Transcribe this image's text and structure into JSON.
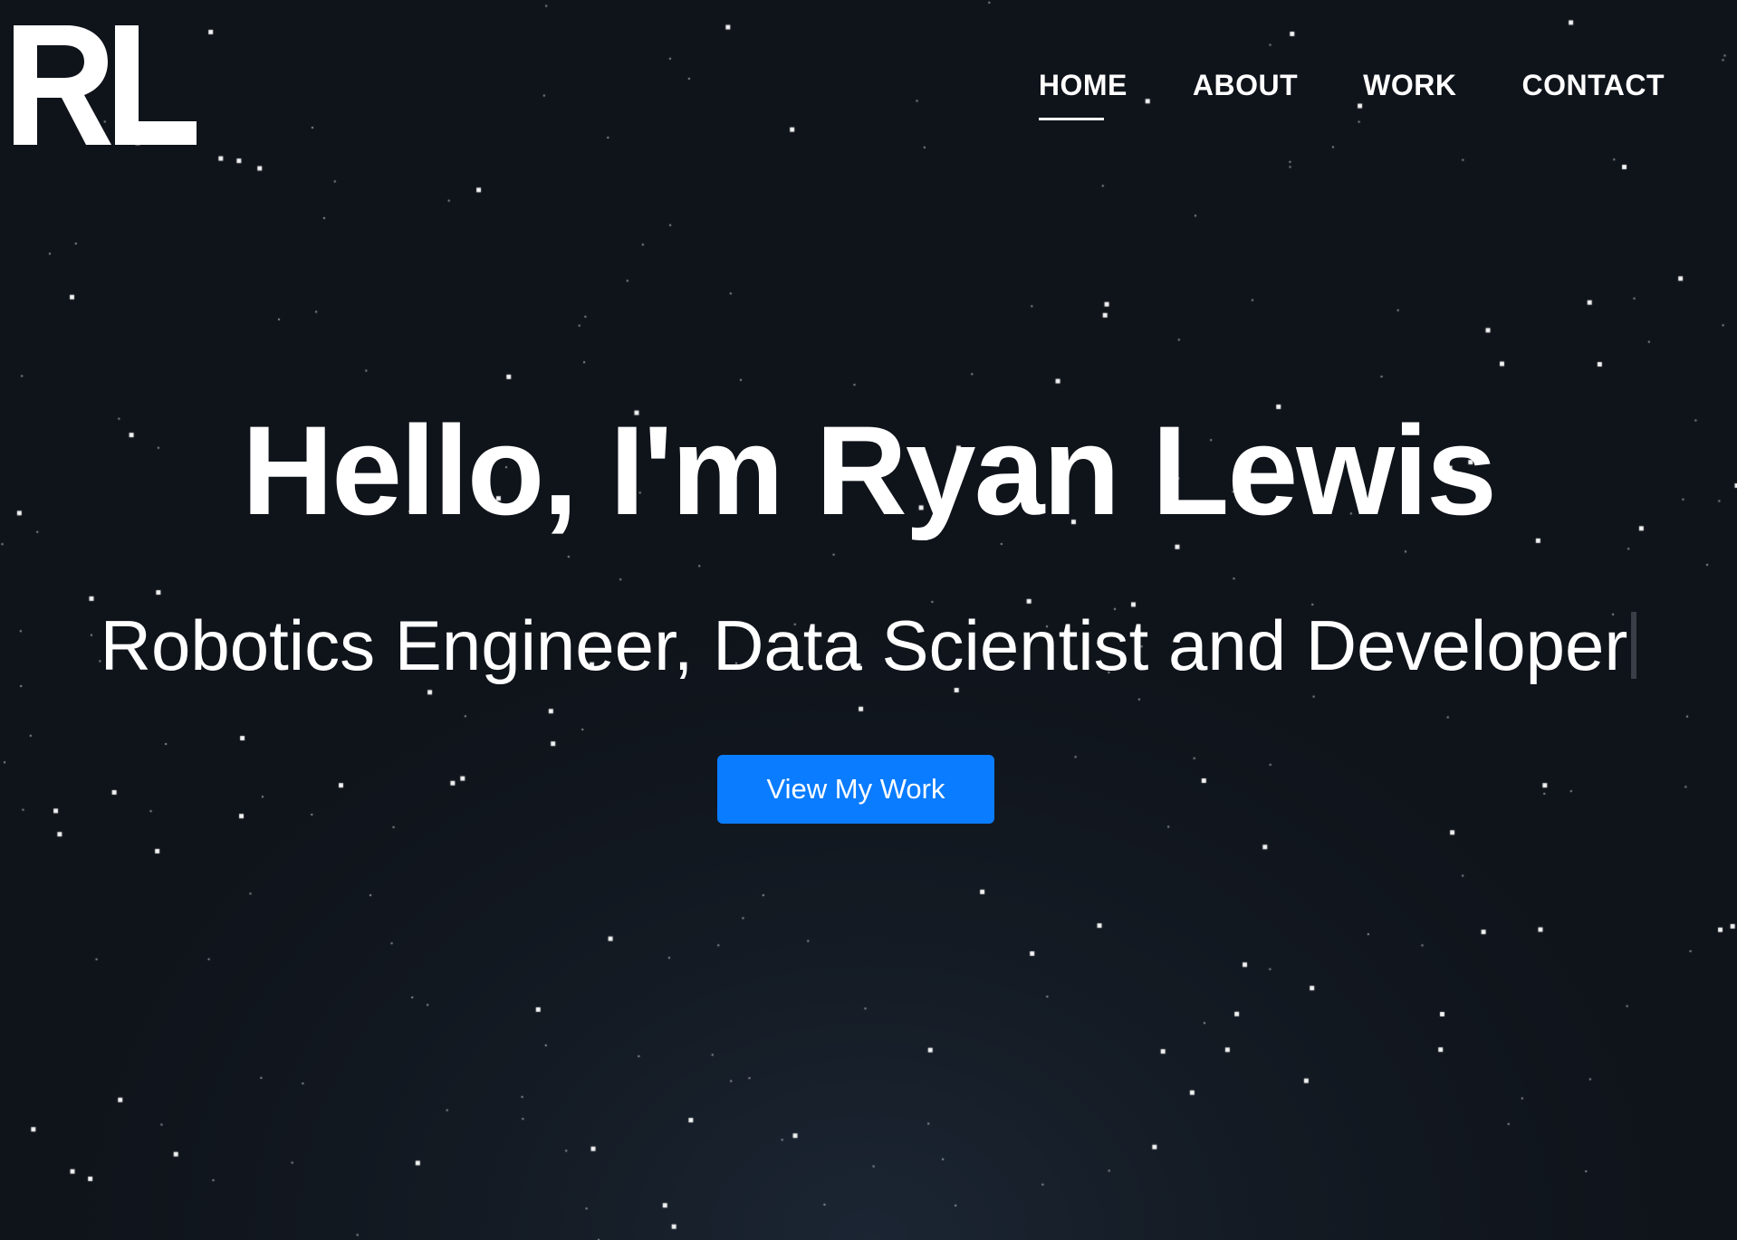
{
  "logo": {
    "text": "RL"
  },
  "nav": {
    "items": [
      {
        "label": "HOME",
        "active": true
      },
      {
        "label": "ABOUT",
        "active": false
      },
      {
        "label": "WORK",
        "active": false
      },
      {
        "label": "CONTACT",
        "active": false
      }
    ]
  },
  "hero": {
    "title": "Hello, I'm Ryan Lewis",
    "subtitle": "Robotics Engineer, Data Scientist and Developer",
    "cta_label": "View My Work"
  },
  "colors": {
    "background": "#0f131a",
    "accent": "#0a7cff",
    "text": "#ffffff"
  }
}
